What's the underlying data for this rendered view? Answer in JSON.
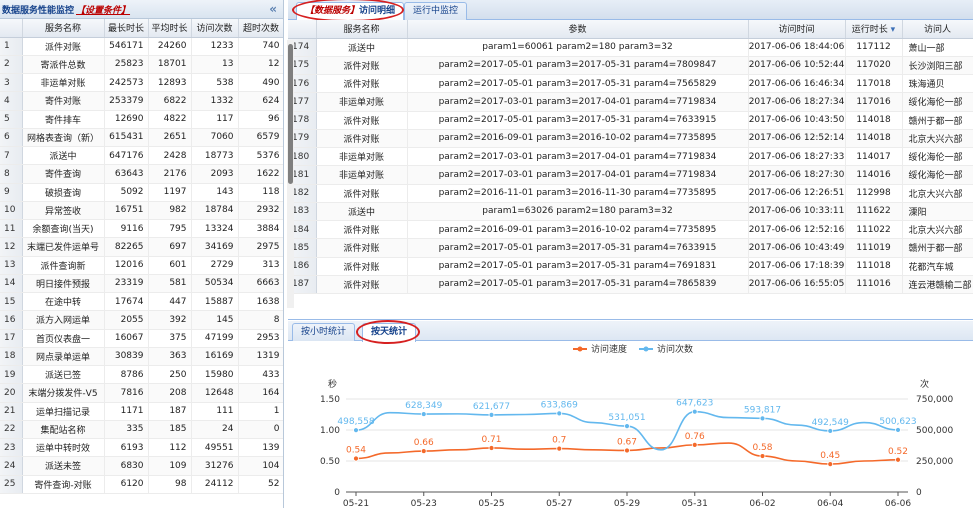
{
  "left_panel": {
    "title": "数据服务性能监控",
    "link": "【设置条件】",
    "collapse_icon": "double-chevron-left-icon",
    "columns": [
      "",
      "服务名称",
      "最长时长",
      "平均时长",
      "访问次数",
      "超时次数"
    ],
    "rows": [
      [
        "1",
        "派件对账",
        "546171",
        "24260",
        "1233",
        "740"
      ],
      [
        "2",
        "寄派件总数",
        "25823",
        "18701",
        "13",
        "12"
      ],
      [
        "3",
        "非运单对账",
        "242573",
        "12893",
        "538",
        "490"
      ],
      [
        "4",
        "寄件对账",
        "253379",
        "6822",
        "1332",
        "624"
      ],
      [
        "5",
        "寄件排车",
        "12690",
        "4822",
        "117",
        "96"
      ],
      [
        "6",
        "网格表查询（新）",
        "615431",
        "2651",
        "7060",
        "6579"
      ],
      [
        "7",
        "派送中",
        "647176",
        "2428",
        "18773",
        "5376"
      ],
      [
        "8",
        "寄件查询",
        "63643",
        "2176",
        "2093",
        "1622"
      ],
      [
        "9",
        "破损查询",
        "5092",
        "1197",
        "143",
        "118"
      ],
      [
        "10",
        "异常签收",
        "16751",
        "982",
        "18784",
        "2932"
      ],
      [
        "11",
        "余额查询(当天)",
        "9116",
        "795",
        "13324",
        "3884"
      ],
      [
        "12",
        "末端已发件运单号",
        "82265",
        "697",
        "34169",
        "2975"
      ],
      [
        "13",
        "派件查询新",
        "12016",
        "601",
        "2729",
        "313"
      ],
      [
        "14",
        "明日接件预报",
        "23319",
        "581",
        "50534",
        "6663"
      ],
      [
        "15",
        "在途中转",
        "17674",
        "447",
        "15887",
        "1638"
      ],
      [
        "16",
        "派方入网运单",
        "2055",
        "392",
        "145",
        "8"
      ],
      [
        "17",
        "首页仪表盘一",
        "16067",
        "375",
        "47199",
        "2953"
      ],
      [
        "18",
        "网点录单运单",
        "30839",
        "363",
        "16169",
        "1319"
      ],
      [
        "19",
        "派送已签",
        "8786",
        "250",
        "15980",
        "433"
      ],
      [
        "20",
        "末端分拨发件-V5",
        "7816",
        "208",
        "12648",
        "164"
      ],
      [
        "21",
        "运单扫描记录",
        "1171",
        "187",
        "111",
        "1"
      ],
      [
        "22",
        "集配站名称",
        "335",
        "185",
        "24",
        "0"
      ],
      [
        "23",
        "运单中转时效",
        "6193",
        "112",
        "49551",
        "139"
      ],
      [
        "24",
        "派送未签",
        "6830",
        "109",
        "31276",
        "104"
      ],
      [
        "25",
        "寄件查询-对账",
        "6120",
        "98",
        "24112",
        "52"
      ]
    ]
  },
  "top_tabs": [
    {
      "prefix": "【数据服务】",
      "label": "访问明细",
      "active": true
    },
    {
      "prefix": "",
      "label": "运行中监控",
      "active": false
    }
  ],
  "detail_grid": {
    "columns": [
      "",
      "服务名称",
      "参数",
      "访问时间",
      "运行时长",
      "访问人"
    ],
    "sort_icon": "sort-desc-icon",
    "rows": [
      [
        "174",
        "派送中",
        "param1=60061 param2=180 param3=32",
        "2017-06-06 18:44:06",
        "117112",
        "萧山一部"
      ],
      [
        "175",
        "派件对账",
        "param2=2017-05-01 param3=2017-05-31 param4=7809847",
        "2017-06-06 10:52:44",
        "117020",
        "长沙浏阳三部"
      ],
      [
        "176",
        "派件对账",
        "param2=2017-05-01 param3=2017-05-31 param4=7565829",
        "2017-06-06 16:46:34",
        "117018",
        "珠海通贝"
      ],
      [
        "177",
        "非运单对账",
        "param2=2017-03-01 param3=2017-04-01 param4=7719834",
        "2017-06-06 18:27:34",
        "117016",
        "绥化海伦一部"
      ],
      [
        "178",
        "派件对账",
        "param2=2017-05-01 param3=2017-05-31 param4=7633915",
        "2017-06-06 10:43:50",
        "114018",
        "赣州于都一部"
      ],
      [
        "179",
        "派件对账",
        "param2=2016-09-01 param3=2016-10-02 param4=7735895",
        "2017-06-06 12:52:14",
        "114018",
        "北京大兴六部"
      ],
      [
        "180",
        "非运单对账",
        "param2=2017-03-01 param3=2017-04-01 param4=7719834",
        "2017-06-06 18:27:33",
        "114017",
        "绥化海伦一部"
      ],
      [
        "181",
        "非运单对账",
        "param2=2017-03-01 param3=2017-04-01 param4=7719834",
        "2017-06-06 18:27:30",
        "114016",
        "绥化海伦一部"
      ],
      [
        "182",
        "派件对账",
        "param2=2016-11-01 param3=2016-11-30 param4=7735895",
        "2017-06-06 12:26:51",
        "112998",
        "北京大兴六部"
      ],
      [
        "183",
        "派送中",
        "param1=63026 param2=180 param3=32",
        "2017-06-06 10:33:11",
        "111622",
        "溧阳"
      ],
      [
        "184",
        "派件对账",
        "param2=2016-09-01 param3=2016-10-02 param4=7735895",
        "2017-06-06 12:52:16",
        "111022",
        "北京大兴六部"
      ],
      [
        "185",
        "派件对账",
        "param2=2017-05-01 param3=2017-05-31 param4=7633915",
        "2017-06-06 10:43:49",
        "111019",
        "赣州于都一部"
      ],
      [
        "186",
        "派件对账",
        "param2=2017-05-01 param3=2017-05-31 param4=7691831",
        "2017-06-06 17:18:39",
        "111018",
        "花都汽车城"
      ],
      [
        "187",
        "派件对账",
        "param2=2017-05-01 param3=2017-05-31 param4=7865839",
        "2017-06-06 16:55:05",
        "111016",
        "连云港赣榆二部"
      ]
    ]
  },
  "bottom_tabs": [
    {
      "label": "按小时统计",
      "active": false
    },
    {
      "label": "按天统计",
      "active": true
    }
  ],
  "chart_data": {
    "type": "line",
    "x": [
      "05-21",
      "05-22",
      "05-23",
      "05-24",
      "05-25",
      "05-26",
      "05-27",
      "05-28",
      "05-29",
      "05-30",
      "05-31",
      "06-01",
      "06-02",
      "06-03",
      "06-04",
      "06-05",
      "06-06"
    ],
    "xticks": [
      "05-21",
      "05-23",
      "05-25",
      "05-27",
      "05-29",
      "05-31",
      "06-02",
      "06-04",
      "06-06"
    ],
    "series": [
      {
        "name": "访问速度",
        "axis": "left",
        "color": "#f4692a",
        "values": [
          0.54,
          0.63,
          0.66,
          0.68,
          0.71,
          0.69,
          0.7,
          0.68,
          0.67,
          0.71,
          0.76,
          0.79,
          0.58,
          0.5,
          0.45,
          0.5,
          0.52
        ],
        "labels": {
          "0": "0.54",
          "2": "0.66",
          "4": "0.71",
          "6": "0.7",
          "8": "0.67",
          "10": "0.76",
          "12": "0.58",
          "14": "0.45",
          "16": "0.52"
        }
      },
      {
        "name": "访问次数",
        "axis": "right",
        "color": "#63b8ee",
        "values": [
          498558,
          640000,
          628349,
          630000,
          621677,
          625000,
          633869,
          560000,
          531051,
          340000,
          647623,
          600000,
          593817,
          540000,
          492549,
          560000,
          500623
        ],
        "labels": {
          "0": "498,558",
          "2": "628,349",
          "4": "621,677",
          "6": "633,869",
          "8": "531,051",
          "10": "647,623",
          "12": "593,817",
          "14": "492,549",
          "16": "500,623"
        }
      }
    ],
    "ylabel_left": "秒",
    "ylabel_right": "次",
    "ylim_left": [
      0,
      1.5
    ],
    "yticks_left": [
      "0",
      "0.50",
      "1.00",
      "1.50"
    ],
    "ylim_right": [
      0,
      750000
    ],
    "yticks_right": [
      "0",
      "250,000",
      "500,000",
      "750,000"
    ],
    "legend": "top-center",
    "grid": true
  }
}
